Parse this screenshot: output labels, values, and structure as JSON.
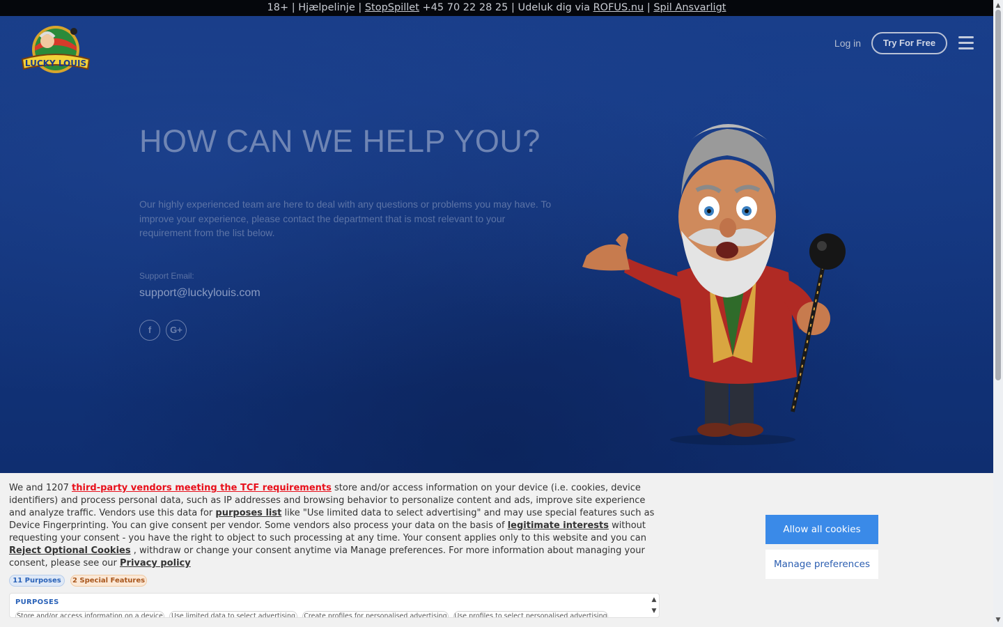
{
  "topbar": {
    "age": "18+ | Hjælpelinje |",
    "stopspillet": "StopSpillet",
    "phone": "+45 70 22 28 25 | Udeluk dig via",
    "rofus": "ROFUS.nu",
    "sep": "|",
    "responsible": "Spil Ansvarligt"
  },
  "header": {
    "logo_text": "LUCKY LOUIS",
    "login": "Log in",
    "try_free": "Try For Free",
    "menu_icon": "hamburger-menu-icon"
  },
  "main": {
    "title": "HOW CAN WE HELP YOU?",
    "intro": "Our highly experienced team are here to deal with any questions or problems you may have. To improve your experience, please contact the department that is most relevant to your requirement from the list below.",
    "support_label": "Support Email:",
    "support_email": "support@luckylouis.com",
    "social": [
      {
        "icon": "facebook-icon",
        "glyph": "f"
      },
      {
        "icon": "google-plus-icon",
        "glyph": "G+"
      }
    ]
  },
  "cookie": {
    "t1": "We and 1207",
    "vendors_link": "third-party vendors meeting the TCF requirements",
    "t2": "store and/or access information on your device (i.e. cookies, device identifiers) and process personal data, such as IP addresses and browsing behavior to personalize content and ads, improve site experience and analyze traffic. Vendors use this data for",
    "purposes_link": "purposes list",
    "t3": "like \"Use limited data to select advertising\" and may use special features such as Device Fingerprinting. You can give consent per vendor. Some vendors also process your data on the basis of",
    "legit_link": "legitimate interests",
    "t4": "without requesting your consent - you have the right to object to such processing at any time. Your consent applies only to this website and you can",
    "reject_link": "Reject Optional Cookies",
    "t5": ", withdraw or change your consent anytime via Manage preferences. For more information about managing your consent, please see our",
    "privacy_link": "Privacy policy",
    "badge_purposes": "11 Purposes",
    "badge_special": "2 Special Features",
    "purposes_title": "PURPOSES",
    "chips": [
      "Store and/or access information on a device",
      "Use limited data to select advertising",
      "Create profiles for personalised advertising",
      "Use profiles to select personalised advertising"
    ],
    "allow_all": "Allow all cookies",
    "manage": "Manage preferences"
  },
  "colors": {
    "hero_bg": "#13357d",
    "allow_button": "#3a8ae8",
    "vendors_link": "#e8101b"
  }
}
